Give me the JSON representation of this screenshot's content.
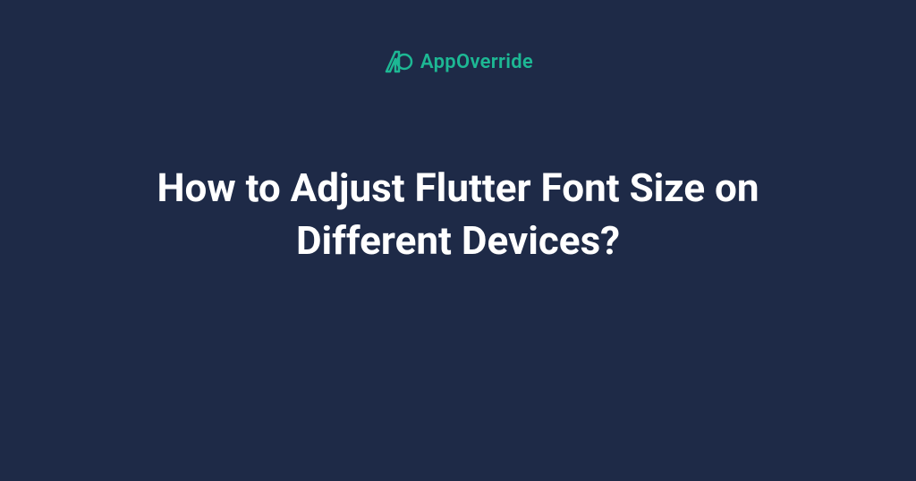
{
  "brand": {
    "name": "AppOverride",
    "accent_color": "#1db894"
  },
  "heading": "How to Adjust Flutter Font Size on Different Devices?",
  "colors": {
    "background": "#1e2a47",
    "text": "#ffffff"
  }
}
